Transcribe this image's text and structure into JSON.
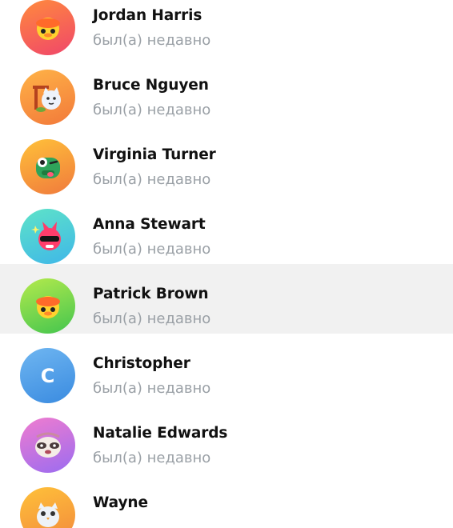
{
  "contacts": [
    {
      "name": "Jordan Harris",
      "status": "был(а) недавно",
      "avatar": {
        "icon": "duck-sticker-icon",
        "gradient": [
          "#ff8a3d",
          "#f0466a"
        ]
      }
    },
    {
      "name": "Bruce Nguyen",
      "status": "был(а) недавно",
      "avatar": {
        "icon": "cat-sticker-icon",
        "gradient": [
          "#ffb347",
          "#f2793a"
        ]
      }
    },
    {
      "name": "Virginia Turner",
      "status": "был(а) недавно",
      "avatar": {
        "icon": "frog-sticker-icon",
        "gradient": [
          "#ffc13a",
          "#f07a3c"
        ]
      }
    },
    {
      "name": "Anna Stewart",
      "status": "был(а) недавно",
      "avatar": {
        "icon": "pink-creature-sticker-icon",
        "gradient": [
          "#5ee3c8",
          "#3fb7e8"
        ]
      }
    },
    {
      "name": "Patrick Brown",
      "status": "был(а) недавно",
      "avatar": {
        "icon": "duck-sticker-icon",
        "gradient": [
          "#b4ea4c",
          "#43c54f"
        ]
      }
    },
    {
      "name": "Christopher",
      "status": "был(а) недавно",
      "avatar": {
        "letter": "C",
        "gradient": [
          "#6fb6f1",
          "#3a8be0"
        ]
      }
    },
    {
      "name": "Natalie Edwards",
      "status": "был(а) недавно",
      "avatar": {
        "icon": "raccoon-sticker-icon",
        "gradient": [
          "#f07ccf",
          "#9b6cf0"
        ]
      }
    },
    {
      "name": "Wayne",
      "status": "",
      "avatar": {
        "icon": "owl-sticker-icon",
        "gradient": [
          "#ffc13a",
          "#f28a3c"
        ]
      }
    }
  ],
  "selected_index": 4
}
